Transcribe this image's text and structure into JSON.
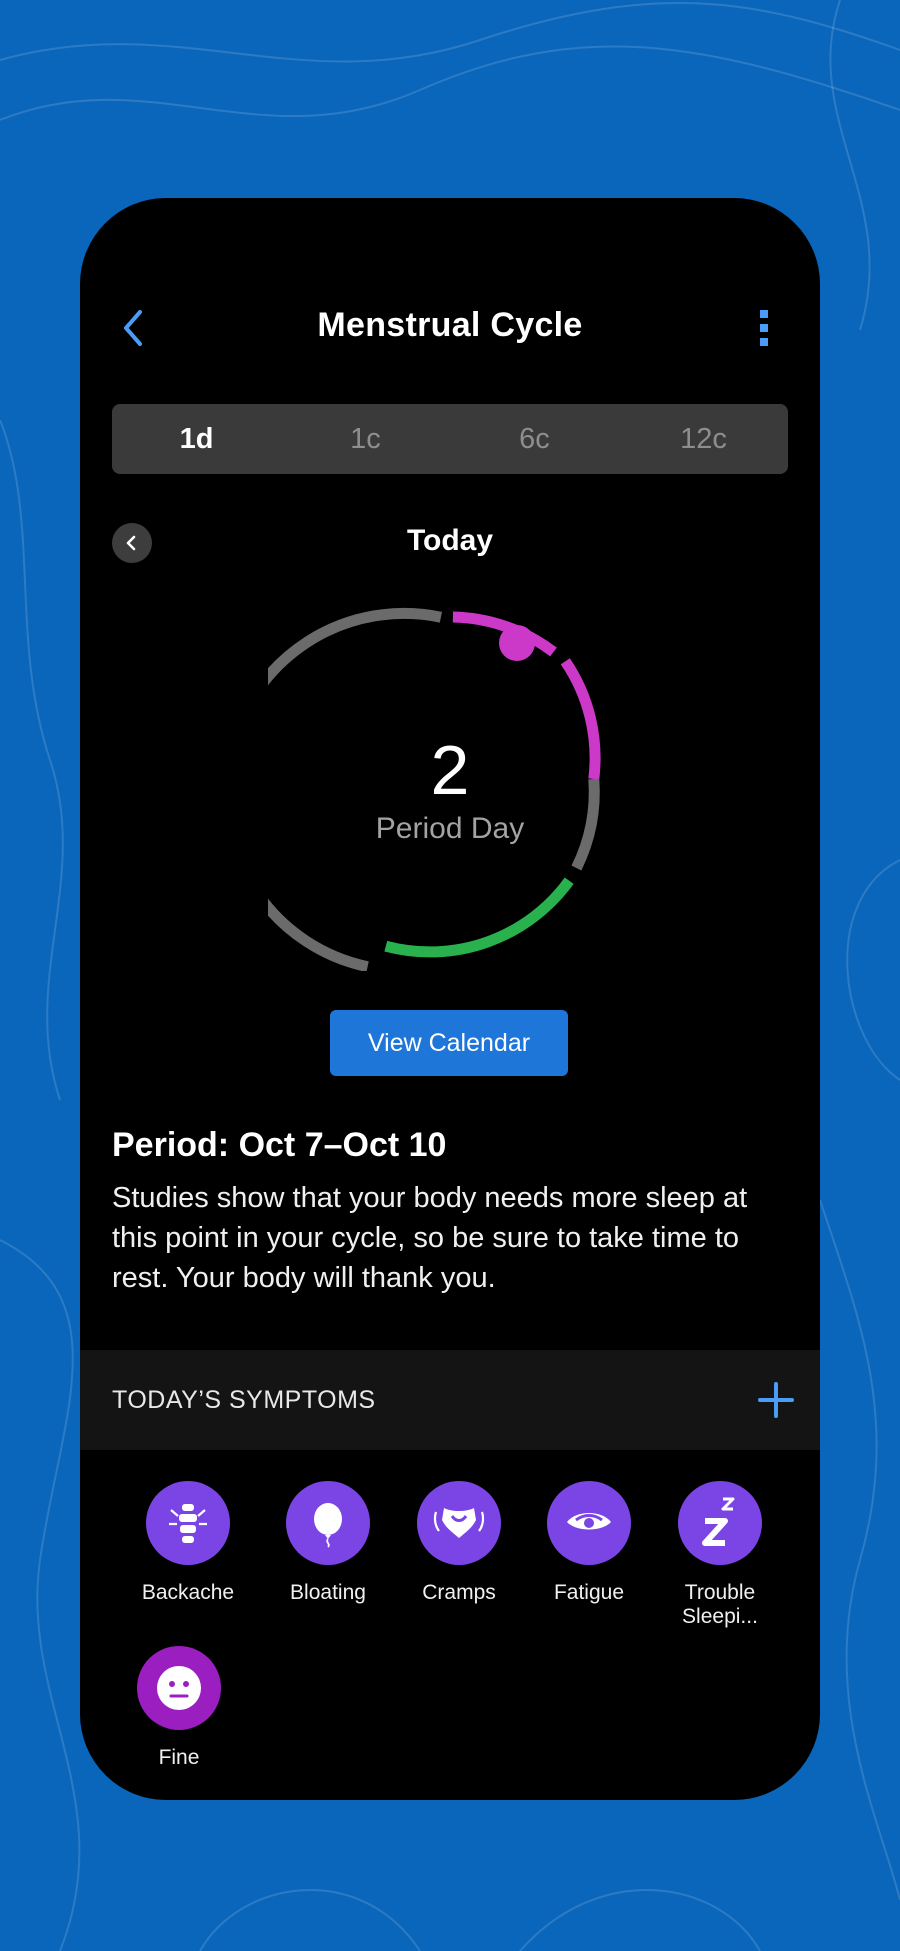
{
  "header": {
    "title": "Menstrual Cycle"
  },
  "segments": [
    {
      "label": "1d",
      "active": true
    },
    {
      "label": "1c",
      "active": false
    },
    {
      "label": "6c",
      "active": false
    },
    {
      "label": "12c",
      "active": false
    }
  ],
  "date_nav": {
    "label": "Today"
  },
  "cycle": {
    "day_number": "2",
    "day_label": "Period Day"
  },
  "view_calendar_label": "View Calendar",
  "period": {
    "title": "Period: Oct 7–Oct 10",
    "description": "Studies show that your body needs more sleep at this point in your cycle, so be sure to take time to rest. Your body will thank you."
  },
  "symptoms": {
    "header": "TODAY’S SYMPTOMS",
    "items": [
      {
        "label": "Backache",
        "icon": "spine-icon"
      },
      {
        "label": "Bloating",
        "icon": "balloon-icon"
      },
      {
        "label": "Cramps",
        "icon": "pelvis-icon"
      },
      {
        "label": "Fatigue",
        "icon": "eye-icon"
      },
      {
        "label": "Trouble Sleepi...",
        "icon": "zzz-icon"
      },
      {
        "label": "Fine",
        "icon": "neutral-face-icon"
      }
    ]
  },
  "colors": {
    "background": "#0a66bb",
    "accent": "#4a9cf5",
    "period": "#cc38c8",
    "fertile": "#29b14e",
    "neutral_ring": "#6b6b6b",
    "symptom": "#7b45e6",
    "mood": "#9a1ec0"
  }
}
